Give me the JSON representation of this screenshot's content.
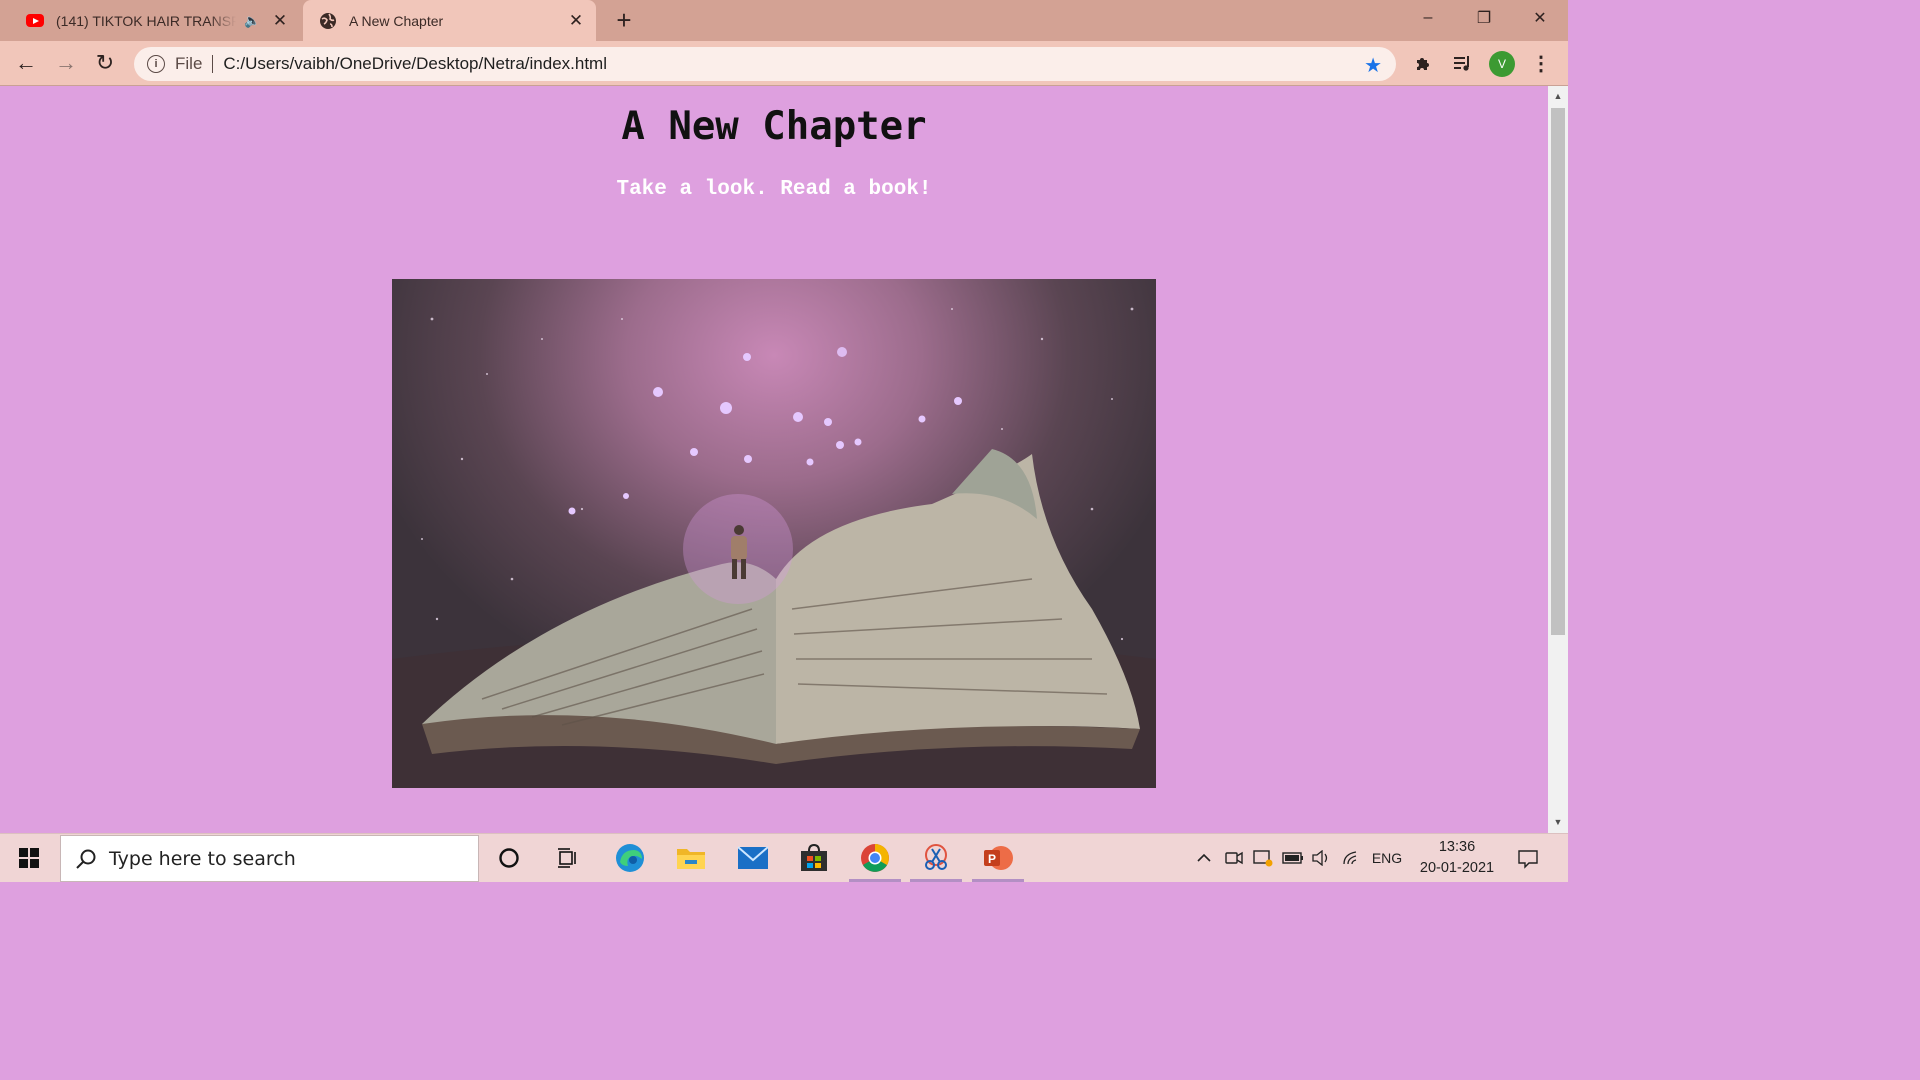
{
  "browser": {
    "tabs": [
      {
        "title": "(141) TIKTOK HAIR TRANSFORMATIONS",
        "favicon": "youtube-icon",
        "audio": true,
        "active": false
      },
      {
        "title": "A New Chapter",
        "favicon": "globe-icon",
        "audio": false,
        "active": true
      }
    ],
    "new_tab_label": "+",
    "window_controls": {
      "minimize": "–",
      "restore": "❐",
      "close": "✕"
    }
  },
  "toolbar": {
    "back": "←",
    "forward": "→",
    "reload": "↻",
    "scheme_label": "File",
    "url": "C:/Users/vaibh/OneDrive/Desktop/Netra/index.html",
    "bookmark_star": "★",
    "profile_initial": "V",
    "accent_color": "#1a73e8",
    "profile_color": "#3c9a32"
  },
  "page": {
    "title": "A New Chapter",
    "subtitle": "Take a look. Read a book!",
    "background_color": "#dea0df",
    "hero_image": "open-book-fantasy-illustration"
  },
  "taskbar": {
    "search_placeholder": "Type here to search",
    "apps": [
      "cortana-icon",
      "task-view-icon",
      "edge-icon",
      "file-explorer-icon",
      "mail-icon",
      "store-icon",
      "chrome-icon",
      "snipping-tool-icon",
      "powerpoint-icon"
    ],
    "tray_language": "ENG",
    "time": "13:36",
    "date": "20-01-2021"
  }
}
